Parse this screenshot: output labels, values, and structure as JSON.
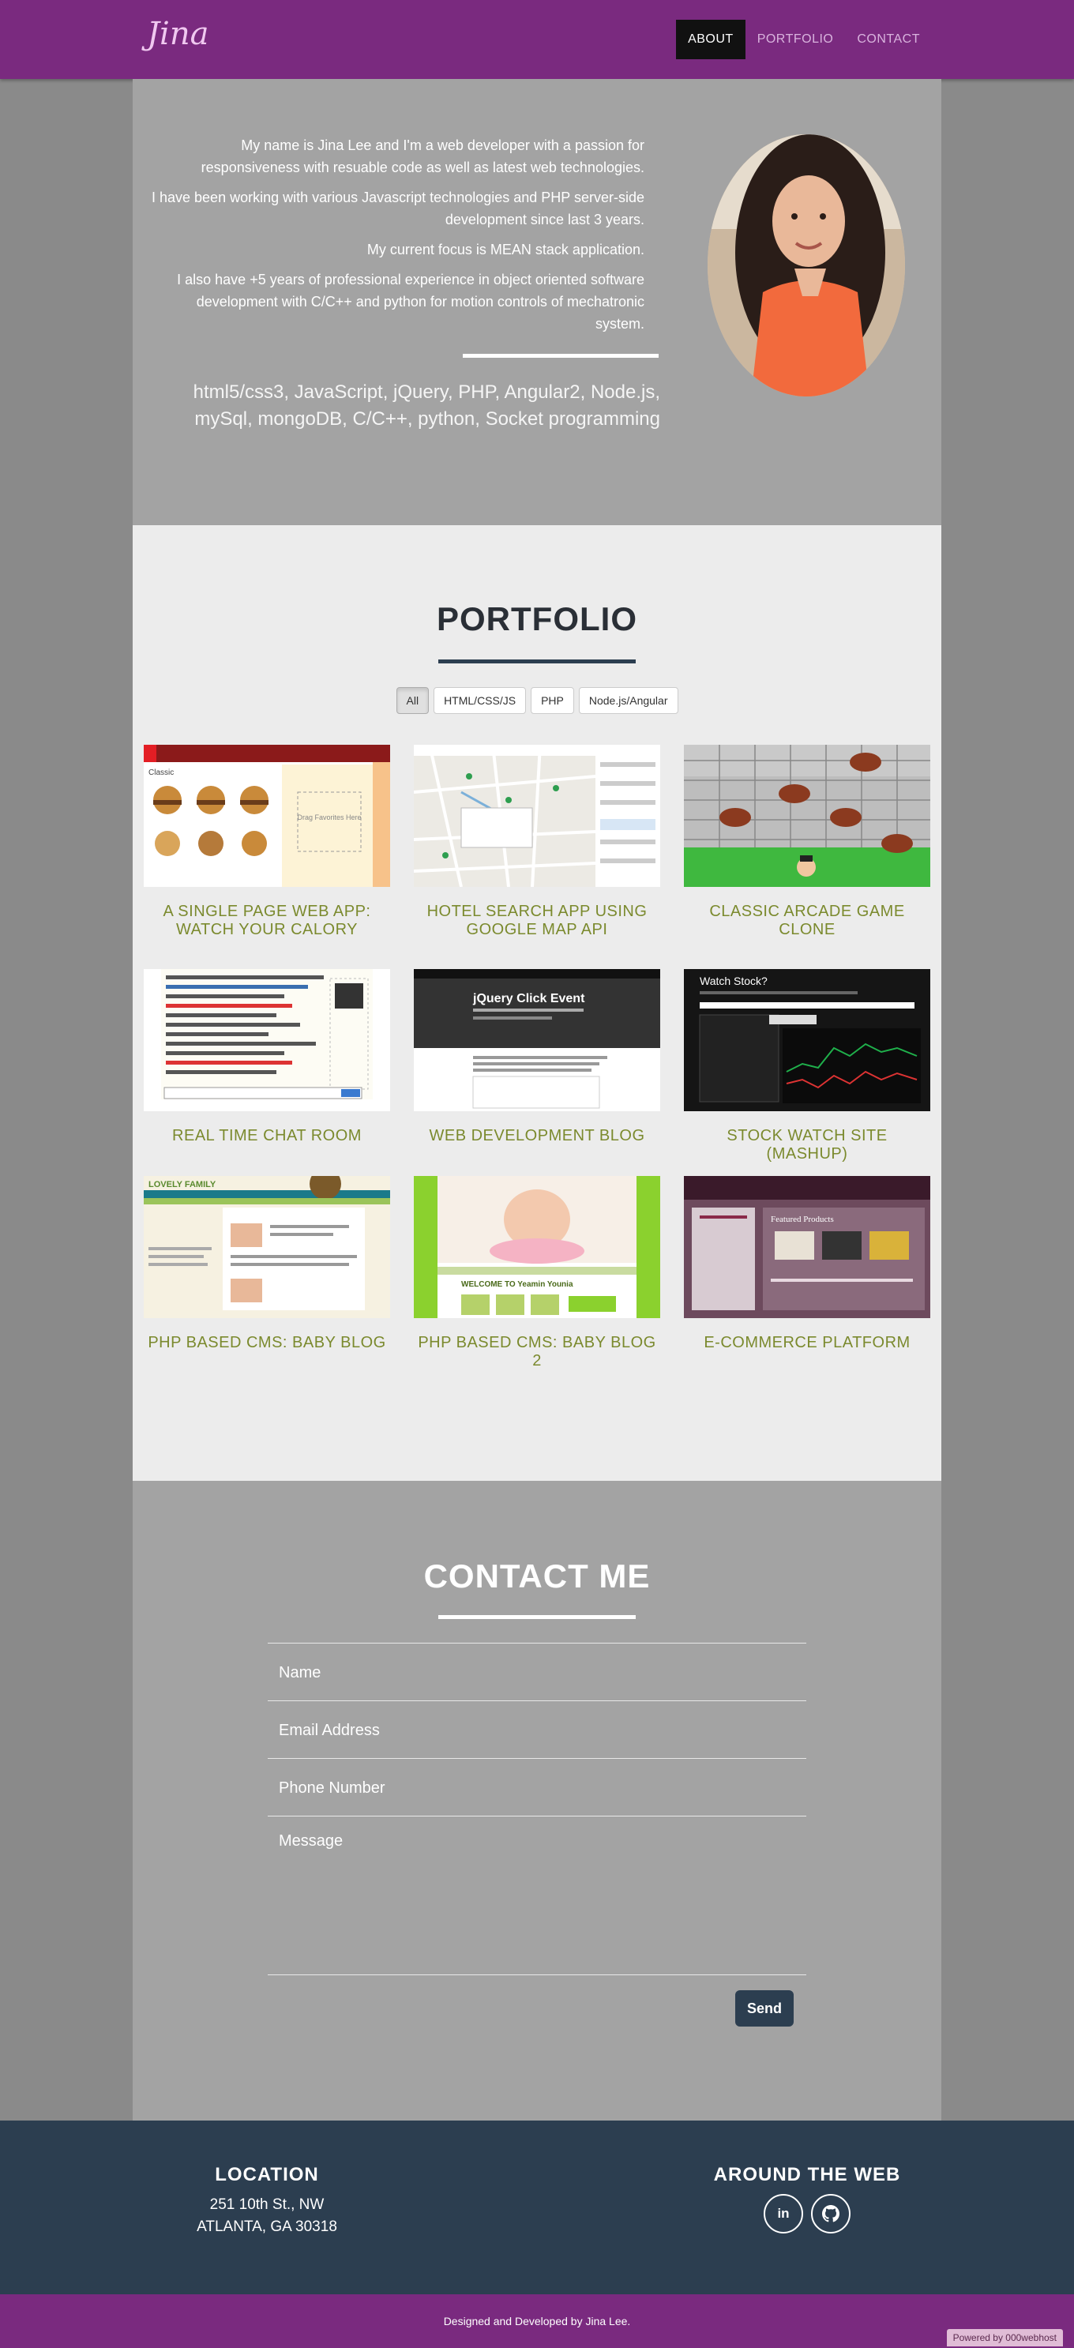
{
  "nav": {
    "brand": "Jina",
    "links": [
      "ABOUT",
      "PORTFOLIO",
      "CONTACT"
    ]
  },
  "about": {
    "paragraphs": [
      "My name is Jina Lee and I'm a web developer with a passion for responsiveness with resuable code as well as latest web technologies.",
      "I have been working with various Javascript technologies and PHP server-side development since last 3 years.",
      "My current focus is MEAN stack application.",
      "I also have +5 years of professional experience in object oriented software development with C/C++ and python for motion controls of mechatronic system."
    ],
    "skills": "html5/css3, JavaScript, jQuery, PHP, Angular2, Node.js, mySql, mongoDB, C/C++, python, Socket programming"
  },
  "portfolio": {
    "title": "PORTFOLIO",
    "filters": [
      "All",
      "HTML/CSS/JS",
      "PHP",
      "Node.js/Angular"
    ],
    "items": [
      {
        "title": "A SINGLE PAGE WEB APP: WATCH YOUR CALORY"
      },
      {
        "title": "HOTEL SEARCH APP USING GOOGLE MAP API"
      },
      {
        "title": "CLASSIC ARCADE GAME CLONE"
      },
      {
        "title": "REAL TIME CHAT ROOM"
      },
      {
        "title": "WEB DEVELOPMENT BLOG"
      },
      {
        "title": "STOCK WATCH SITE (MASHUP)"
      },
      {
        "title": "PHP BASED CMS: BABY BLOG"
      },
      {
        "title": "PHP BASED CMS: BABY BLOG 2"
      },
      {
        "title": "E-COMMERCE PLATFORM"
      }
    ],
    "thumb_text": {
      "calory": "Classic",
      "drag": "Drag Favorites Here",
      "jquery": "jQuery Click Event",
      "stock": "Watch Stock?",
      "lovely": "LOVELY FAMILY",
      "welcome": "WELCOME TO Yeamin Younia",
      "shop": "Featured Products"
    }
  },
  "contact": {
    "title": "CONTACT ME",
    "placeholders": [
      "Name",
      "Email Address",
      "Phone Number",
      "Message"
    ],
    "send": "Send"
  },
  "footer": {
    "location_title": "LOCATION",
    "address1": "251 10th St., NW",
    "address2": "ATLANTA, GA 30318",
    "web_title": "AROUND THE WEB",
    "linkedin": "in",
    "github": "⌥",
    "credit": "Designed and Developed by Jina Lee.",
    "webhost": "Powered by 000webhost"
  },
  "colors": {
    "nav": "#7a2a7f",
    "footer": "#2c3e50",
    "accent_green": "#7b8a2e"
  }
}
